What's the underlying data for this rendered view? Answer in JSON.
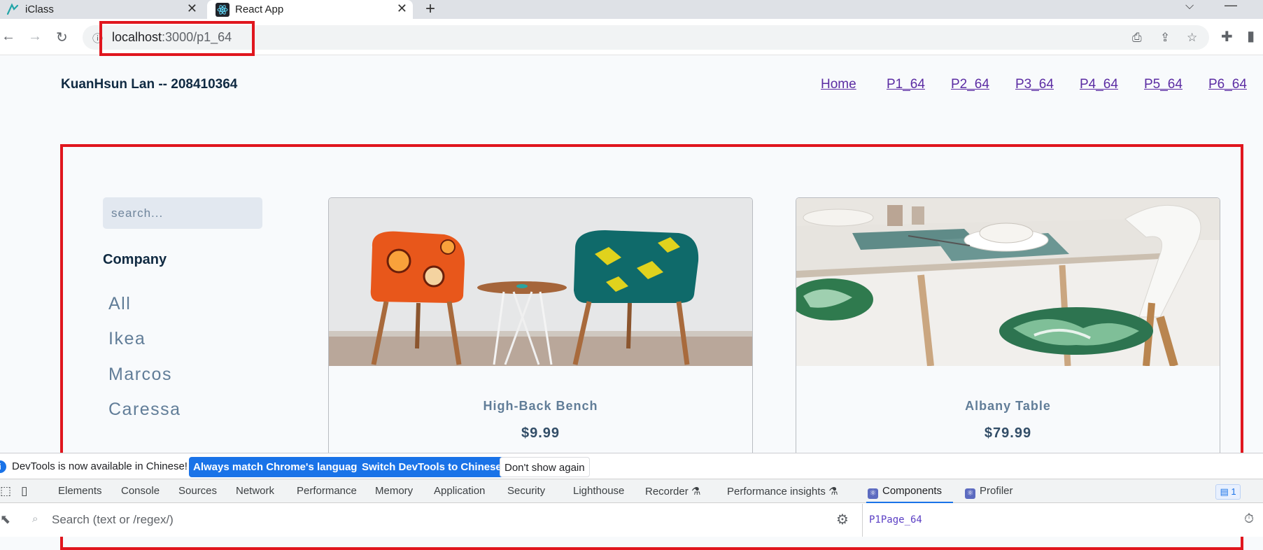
{
  "browser": {
    "tabs": [
      {
        "title": "iClass",
        "icon": "iclass-favicon-icon"
      },
      {
        "title": "React App",
        "icon": "react-favicon-icon"
      }
    ],
    "close_glyph": "✕",
    "new_tab_glyph": "+",
    "url": {
      "host": "localhost",
      "path": ":3000/p1_64"
    }
  },
  "page": {
    "brand": "KuanHsun Lan -- 208410364",
    "nav": [
      "Home",
      "P1_64",
      "P2_64",
      "P3_64",
      "P4_64",
      "P5_64",
      "P6_64"
    ],
    "search_placeholder": "search...",
    "company_heading": "Company",
    "companies": [
      "All",
      "Ikea",
      "Marcos",
      "Caressa"
    ],
    "products": [
      {
        "name": "High-Back Bench",
        "price": "$9.99"
      },
      {
        "name": "Albany Table",
        "price": "$79.99"
      }
    ],
    "highlight_color": "#e0161e"
  },
  "devtools": {
    "info_text": "DevTools is now available in Chinese!",
    "info_buttons": [
      "Always match Chrome's language",
      "Switch DevTools to Chinese",
      "Don't show again"
    ],
    "tabs": [
      "Elements",
      "Console",
      "Sources",
      "Network",
      "Performance",
      "Memory",
      "Application",
      "Security",
      "Lighthouse",
      "Recorder",
      "Performance insights",
      "Components",
      "Profiler"
    ],
    "active_tab": "Components",
    "search_placeholder": "Search (text or /regex/)",
    "selected_component": "P1Page_64"
  }
}
